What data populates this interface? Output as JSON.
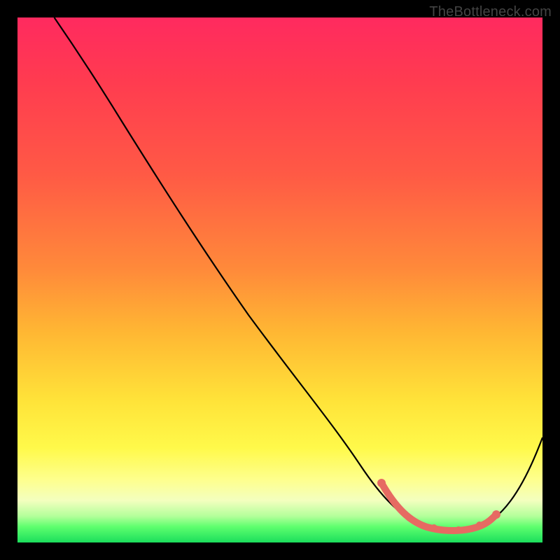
{
  "watermark": "TheBottleneck.com",
  "chart_data": {
    "type": "line",
    "title": "",
    "xlabel": "",
    "ylabel": "",
    "xlim": [
      0,
      100
    ],
    "ylim": [
      0,
      100
    ],
    "series": [
      {
        "name": "curve",
        "x": [
          7,
          14,
          20,
          30,
          40,
          50,
          60,
          64,
          70,
          74,
          78,
          82,
          86,
          90,
          100
        ],
        "y": [
          100,
          93,
          86,
          74,
          61,
          49,
          36,
          27,
          14,
          7,
          3,
          2,
          2,
          5,
          22
        ]
      },
      {
        "name": "highlight-band",
        "x": [
          70,
          74,
          78,
          82,
          86,
          90
        ],
        "y": [
          14,
          7,
          3,
          2,
          2,
          5
        ]
      }
    ],
    "background_gradient": {
      "orientation": "vertical",
      "stops": [
        {
          "pos": 0.0,
          "color": "#ff2a5f"
        },
        {
          "pos": 0.48,
          "color": "#ff8a3a"
        },
        {
          "pos": 0.82,
          "color": "#fff94a"
        },
        {
          "pos": 1.0,
          "color": "#1bde5c"
        }
      ]
    }
  }
}
